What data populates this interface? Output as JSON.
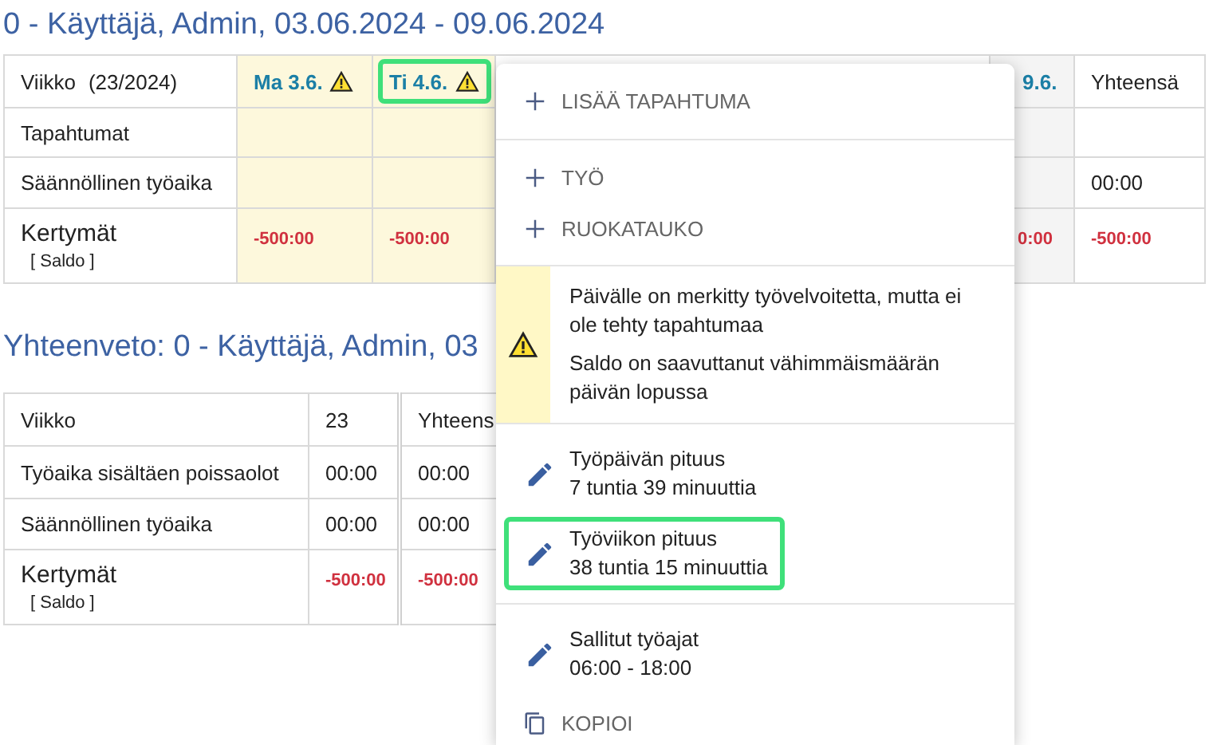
{
  "title": "0 - Käyttäjä, Admin, 03.06.2024 - 09.06.2024",
  "week_table": {
    "corner": {
      "label": "Viikko",
      "week": "(23/2024)"
    },
    "days": [
      {
        "label": "Ma 3.6.",
        "warning": true,
        "highlighted": false
      },
      {
        "label": "Ti 4.6.",
        "warning": true,
        "highlighted": true
      },
      {
        "label": "9.6.",
        "warning": false,
        "highlighted": false
      }
    ],
    "total_label": "Yhteensä",
    "rows": [
      {
        "label": "Tapahtumat",
        "kind": "time",
        "cells": [
          "",
          "",
          "",
          ""
        ]
      },
      {
        "label": "Säännöllinen työaika",
        "kind": "time",
        "cells": [
          "",
          "",
          "",
          "00:00"
        ]
      },
      {
        "label": "Kertymät",
        "sublabel": "[ Saldo ]",
        "kind": "balance",
        "cells": [
          "-500:00",
          "-500:00",
          "0:00",
          "-500:00"
        ]
      }
    ]
  },
  "summary": {
    "title": "Yhteenveto: 0 - Käyttäjä, Admin, 03",
    "header_row": {
      "label": "Viikko",
      "cells": [
        "23",
        "Yhteens"
      ]
    },
    "rows": [
      {
        "label": "Työaika sisältäen poissaolot",
        "kind": "time",
        "cells": [
          "00:00",
          "00:00"
        ]
      },
      {
        "label": "Säännöllinen työaika",
        "kind": "time",
        "cells": [
          "00:00",
          "00:00"
        ]
      },
      {
        "label": "Kertymät",
        "sublabel": "[ Saldo ]",
        "kind": "balance",
        "cells": [
          "-500:00",
          "-500:00"
        ]
      }
    ]
  },
  "popup": {
    "add_event": "LISÄÄ TAPAHTUMA",
    "event_types": [
      "TYÖ",
      "RUOKATAUKO"
    ],
    "warnings": [
      "Päivälle on merkitty työvelvoitetta, mutta ei ole tehty tapahtumaa",
      "Saldo on saavuttanut vähimmäismäärän päivän lopussa"
    ],
    "settings": [
      {
        "items": [
          {
            "label": "Työpäivän pituus",
            "value": "7 tuntia 39 minuuttia",
            "highlighted": false
          },
          {
            "label": "Työviikon pituus",
            "value": "38 tuntia 15 minuuttia",
            "highlighted": true
          }
        ]
      },
      {
        "items": [
          {
            "label": "Sallitut työajat",
            "value": "06:00 - 18:00",
            "highlighted": false
          }
        ]
      }
    ],
    "copy": "KOPIOI"
  }
}
